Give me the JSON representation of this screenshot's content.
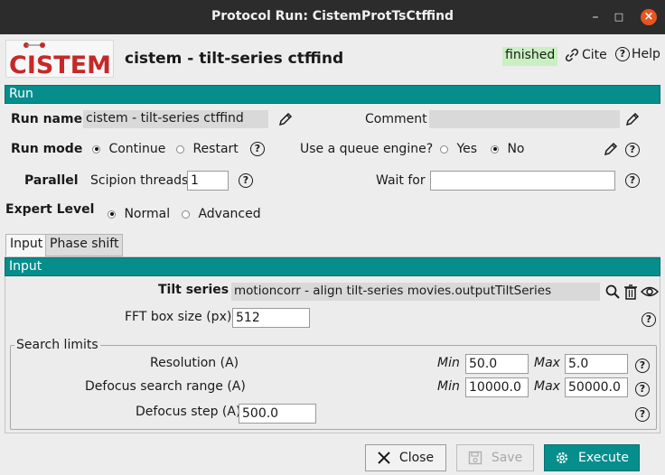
{
  "window": {
    "title": "Protocol Run: CistemProtTsCtffind"
  },
  "header": {
    "logo_text": "CISTEM",
    "title": "cistem - tilt-series ctffind",
    "status": "finished",
    "cite_label": "Cite",
    "help_label": "Help"
  },
  "run": {
    "section_label": "Run",
    "run_name_label": "Run name",
    "run_name_value": "cistem - tilt-series ctffind",
    "comment_label": "Comment",
    "comment_value": "",
    "run_mode_label": "Run mode",
    "run_mode_options": [
      "Continue",
      "Restart"
    ],
    "run_mode_selected": "Continue",
    "queue_label": "Use a queue engine?",
    "queue_options": [
      "Yes",
      "No"
    ],
    "queue_selected": "No",
    "parallel_label": "Parallel",
    "threads_label": "Scipion threads",
    "threads_value": "1",
    "wait_for_label": "Wait for",
    "wait_for_value": ""
  },
  "expert": {
    "label": "Expert Level",
    "options": [
      "Normal",
      "Advanced"
    ],
    "selected": "Normal"
  },
  "tabs": [
    {
      "label": "Input",
      "active": true
    },
    {
      "label": "Phase shift",
      "active": false
    }
  ],
  "input": {
    "section_label": "Input",
    "tilt_series_label": "Tilt series",
    "tilt_series_value": "motioncorr - align tilt-series movies.outputTiltSeries",
    "fft_label": "FFT box size (px)",
    "fft_value": "512",
    "search_limits": {
      "label": "Search limits",
      "min_label": "Min",
      "max_label": "Max",
      "resolution_label": "Resolution (A)",
      "resolution_min": "50.0",
      "resolution_max": "5.0",
      "defocus_range_label": "Defocus search range (A)",
      "defocus_min": "10000.0",
      "defocus_max": "50000.0",
      "defocus_step_label": "Defocus step (A)",
      "defocus_step_value": "500.0"
    }
  },
  "buttons": {
    "close": "Close",
    "save": "Save",
    "execute": "Execute"
  },
  "colors": {
    "accent": "#058e8c",
    "status_bg": "#c8f0c0",
    "titlebar": "#2c2c2c",
    "close_button": "#e95420"
  }
}
